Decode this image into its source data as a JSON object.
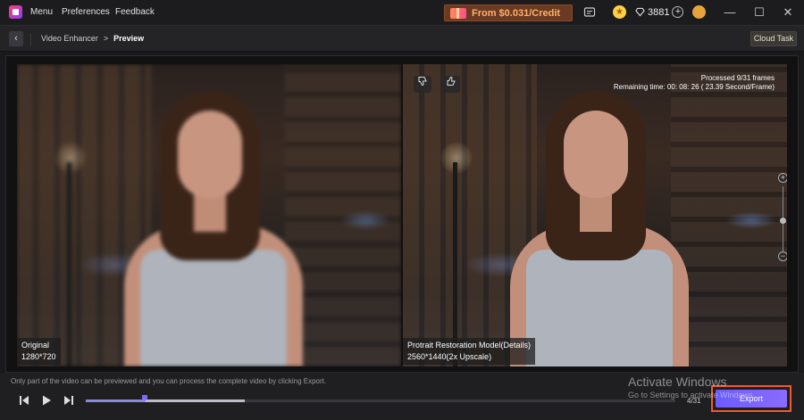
{
  "titlebar": {
    "menu_items": [
      "Menu",
      "Preferences",
      "Feedback"
    ],
    "promo_text": "From $0.031/Credit",
    "credits": "3881"
  },
  "breadcrumb": {
    "parent": "Video Enhancer",
    "separator": ">",
    "current": "Preview",
    "cloud_task_label": "Cloud Task"
  },
  "preview": {
    "original": {
      "title": "Original",
      "resolution": "1280*720"
    },
    "enhanced": {
      "model": "Protrait Restoration Model(Details)",
      "resolution": "2560*1440(2x Upscale)"
    },
    "processed": "Processed 9/31 frames",
    "remaining": "Remaining time: 00: 08: 26 ( 23.39 Second/Frame)",
    "icons": [
      "thumbs-down-icon",
      "thumbs-up-icon",
      "zoom-in-icon",
      "zoom-out-icon"
    ]
  },
  "bottom": {
    "hint": "Only part of the video can be previewed and you can process the complete video by clicking Export.",
    "frame_counter": "4/31",
    "export_label": "Export",
    "playhead_fraction": 0.1,
    "buffered_fraction": 0.27
  },
  "watermark": {
    "title": "Activate Windows",
    "subtitle": "Go to Settings to activate Windows."
  },
  "colors": {
    "accent": "#7a6cff",
    "promo_text": "#ffb06a",
    "highlight_border": "#f05a28"
  }
}
